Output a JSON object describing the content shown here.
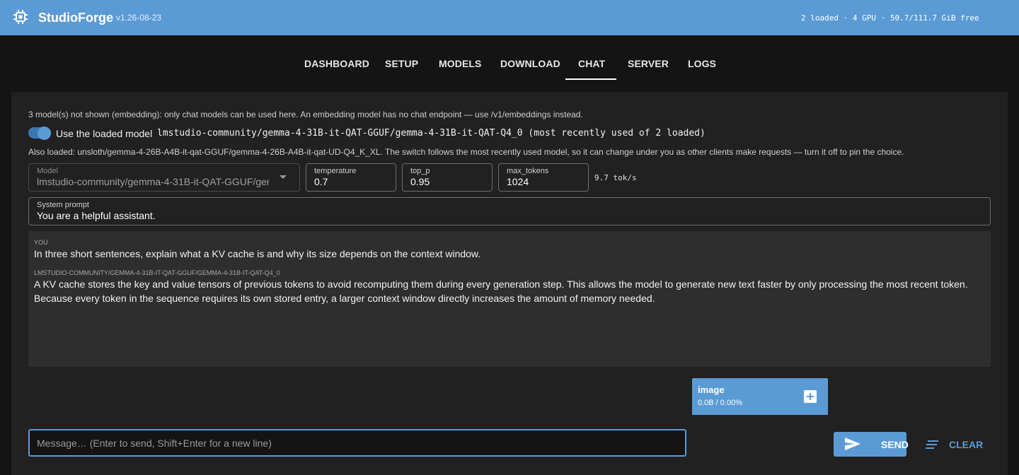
{
  "header": {
    "title": "StudioForge",
    "version": "v1.26-08-23",
    "status": "2 loaded · 4 GPU · 50.7/111.7 GiB free",
    "logo_icon": "chip-icon"
  },
  "nav": {
    "tabs": [
      {
        "label": "DASHBOARD"
      },
      {
        "label": "SETUP"
      },
      {
        "label": "MODELS"
      },
      {
        "label": "DOWNLOAD"
      },
      {
        "label": "CHAT"
      },
      {
        "label": "SERVER"
      },
      {
        "label": "LOGS"
      }
    ],
    "active": "CHAT"
  },
  "chat": {
    "notice": "3 model(s) not shown (embedding): only chat models can be used here. An embedding model has no chat endpoint — use /v1/embeddings instead.",
    "use_loaded": {
      "on": true,
      "label": "Use the loaded model",
      "model": "lmstudio-community/gemma-4-31B-it-QAT-GGUF/gemma-4-31B-it-QAT-Q4_0 (most recently used of 2 loaded)"
    },
    "also_loaded": "Also loaded: unsloth/gemma-4-26B-A4B-it-qat-GGUF/gemma-4-26B-A4B-it-qat-UD-Q4_K_XL. The switch follows the most recently used model, so it can change under you as other clients make requests — turn it off to pin the choice.",
    "params": {
      "model_label": "Model",
      "model_value": "lmstudio-community/gemma-4-31B-it-QAT-GGUF/gemma-4-31B-it-QAT-Q4_0",
      "temperature_label": "temperature",
      "temperature_value": "0.7",
      "top_p_label": "top_p",
      "top_p_value": "0.95",
      "max_tokens_label": "max_tokens",
      "max_tokens_value": "1024",
      "rate": "9.7 tok/s"
    },
    "system_prompt": {
      "label": "System prompt",
      "value": "You are a helpful assistant."
    },
    "messages": [
      {
        "role": "YOU",
        "text": "In three short sentences, explain what a KV cache is and why its size depends on the context window."
      },
      {
        "role": "LMSTUDIO-COMMUNITY/GEMMA-4-31B-IT-QAT-GGUF/GEMMA-4-31B-IT-QAT-Q4_0",
        "text": "A KV cache stores the key and value tensors of previous tokens to avoid recomputing them during every generation step. This allows the model to generate new text faster by only processing the most recent token. Because every token in the sequence requires its own stored entry, a larger context window directly increases the amount of memory needed."
      }
    ],
    "attachment": {
      "title": "image",
      "meta": "0.0B / 0.00%",
      "add_icon": "plus-icon"
    },
    "input": {
      "placeholder": "Message… (Enter to send, Shift+Enter for a new line)",
      "value": ""
    },
    "send_label": "SEND",
    "clear_label": "CLEAR",
    "send_icon": "send-icon",
    "clear_icon": "clear-lines-icon"
  },
  "colors": {
    "accent": "#5b9bd5",
    "background": "#141414",
    "panel": "#212121",
    "chat_log": "#2e2e2e"
  }
}
